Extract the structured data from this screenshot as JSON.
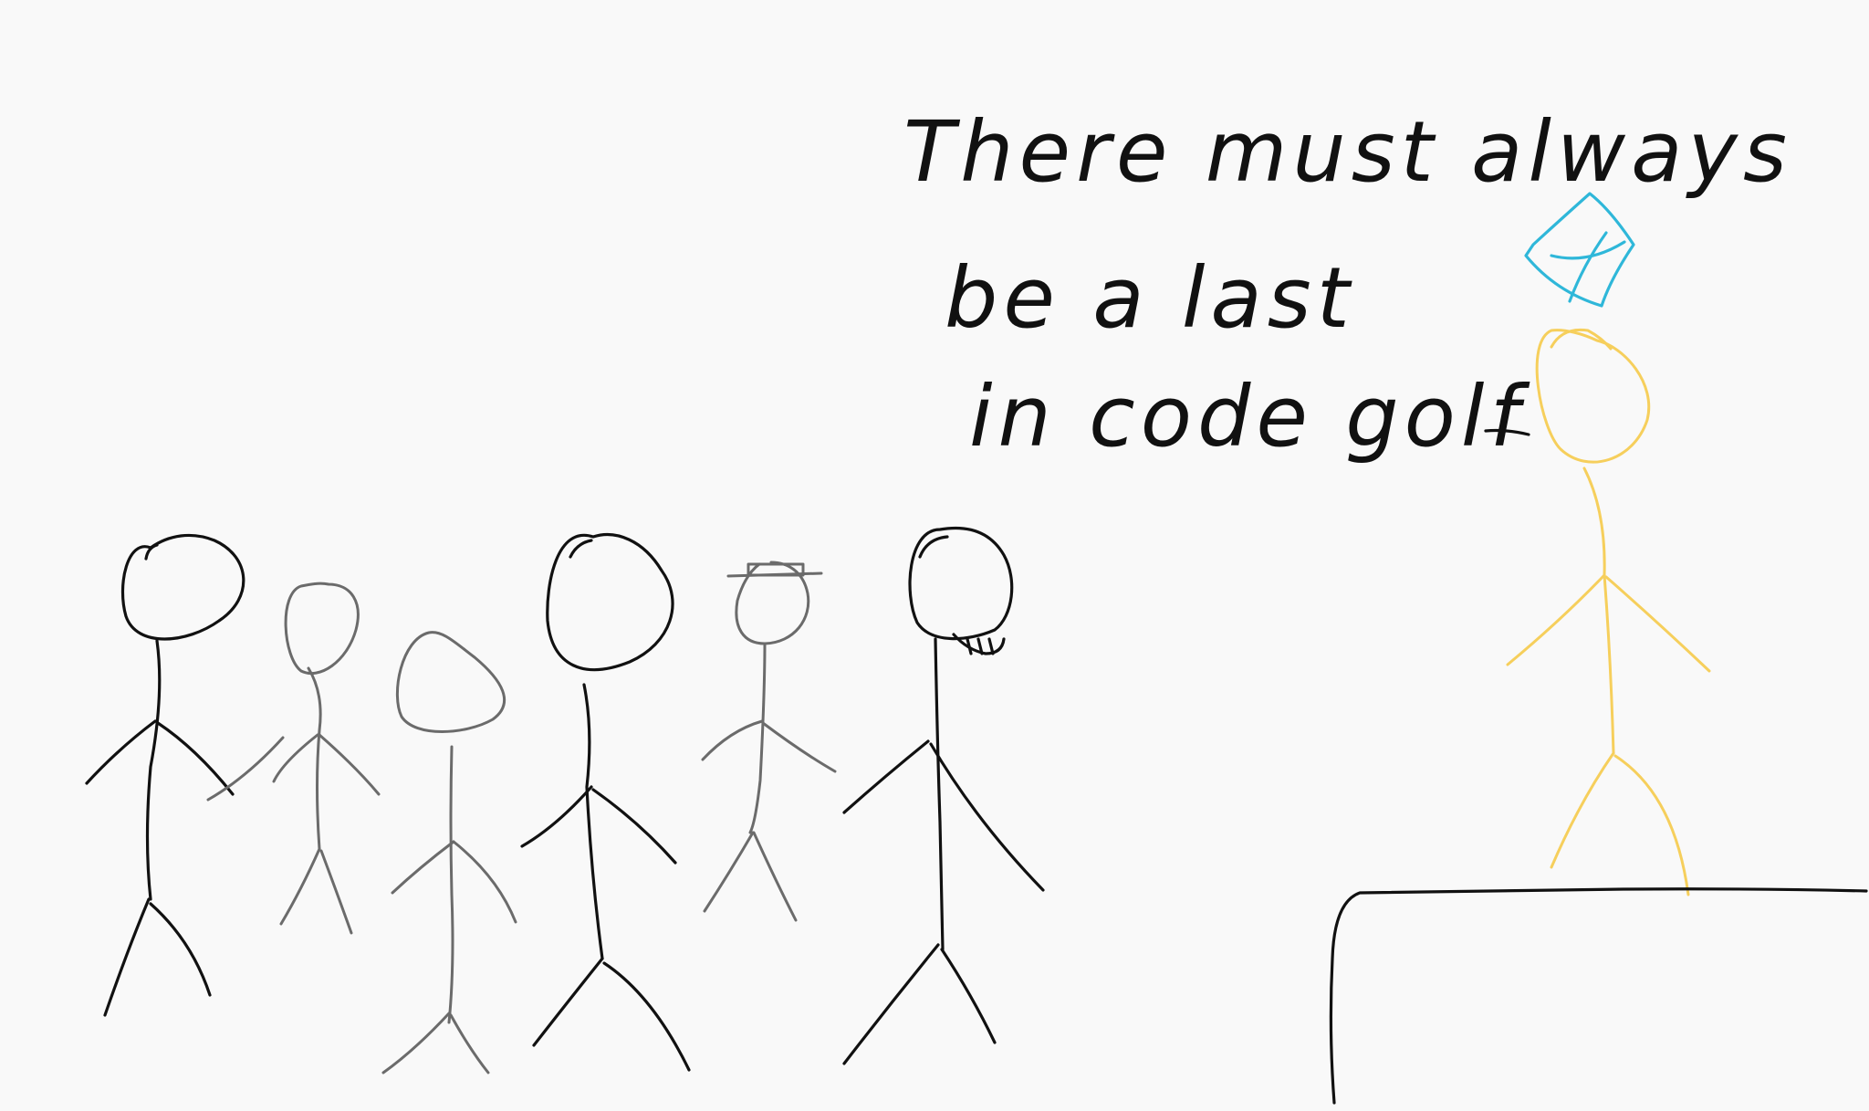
{
  "caption": {
    "line1": "There must always",
    "line2": "be a last",
    "line3": "in code golf"
  },
  "colors": {
    "background": "#f9f9f9",
    "ink_black": "#111111",
    "ink_gray": "#6b6b6b",
    "ink_yellow": "#f6cf5c",
    "ink_blue": "#2fb7d9"
  },
  "figures": [
    {
      "name": "stick-figure-1",
      "ink": "black"
    },
    {
      "name": "stick-figure-2",
      "ink": "gray"
    },
    {
      "name": "stick-figure-3",
      "ink": "gray"
    },
    {
      "name": "stick-figure-4",
      "ink": "black"
    },
    {
      "name": "stick-figure-5-top-hat",
      "ink": "gray"
    },
    {
      "name": "stick-figure-6-beard",
      "ink": "black"
    },
    {
      "name": "stick-figure-winner",
      "ink": "yellow"
    }
  ]
}
